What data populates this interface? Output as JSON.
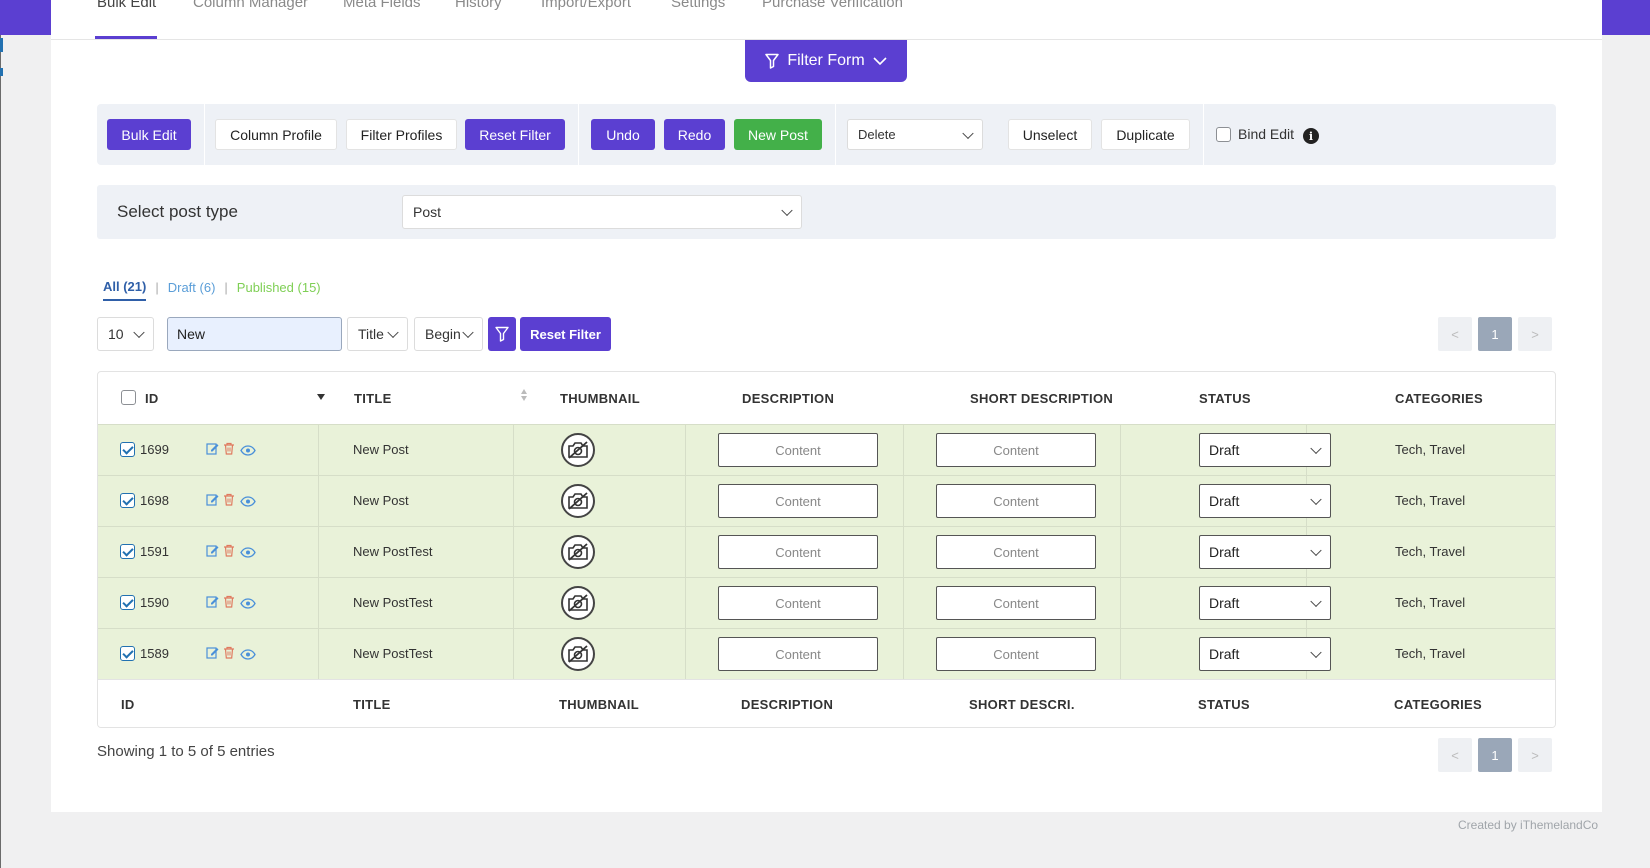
{
  "nav": {
    "tabs": [
      {
        "label": "Bulk Edit",
        "active": true
      },
      {
        "label": "Column Manager",
        "active": false
      },
      {
        "label": "Meta Fields",
        "active": false
      },
      {
        "label": "History",
        "active": false
      },
      {
        "label": "Import/Export",
        "active": false
      },
      {
        "label": "Settings",
        "active": false
      },
      {
        "label": "Purchase Verification",
        "active": false
      }
    ]
  },
  "filter_form": {
    "label": "Filter Form",
    "icon": "funnel-icon"
  },
  "toolbar": {
    "bulk_edit": "Bulk Edit",
    "column_profile": "Column Profile",
    "filter_profiles": "Filter Profiles",
    "reset_filter": "Reset Filter",
    "undo": "Undo",
    "redo": "Redo",
    "new_post": "New Post",
    "action_select": "Delete",
    "unselect": "Unselect",
    "duplicate": "Duplicate",
    "bind_edit": "Bind Edit",
    "bind_edit_checked": false,
    "info_icon": "i"
  },
  "post_type": {
    "label": "Select post type",
    "selected": "Post"
  },
  "status_tabs": {
    "all": "All (21)",
    "draft": "Draft (6)",
    "published": "Published (15)"
  },
  "quick_filter": {
    "per_page": "10",
    "search_value": "New",
    "field": "Title",
    "operator": "Begin",
    "reset_filter": "Reset Filter"
  },
  "pagination": {
    "prev": "<",
    "current": "1",
    "next": ">"
  },
  "table": {
    "headers": {
      "id": "ID",
      "title": "TITLE",
      "thumbnail": "THUMBNAIL",
      "description": "DESCRIPTION",
      "short_description": "SHORT DESCRIPTION",
      "status": "STATUS",
      "categories": "CATEGORIES"
    },
    "footers": {
      "id": "ID",
      "title": "TITLE",
      "thumbnail": "THUMBNAIL",
      "description": "DESCRIPTION",
      "short_description": "SHORT DESCRI.",
      "status": "STATUS",
      "categories": "CATEGORIES"
    },
    "rows": [
      {
        "id": "1699",
        "title": "New Post",
        "description": "Content",
        "short_description": "Content",
        "status": "Draft",
        "categories": "Tech, Travel"
      },
      {
        "id": "1698",
        "title": "New Post",
        "description": "Content",
        "short_description": "Content",
        "status": "Draft",
        "categories": "Tech, Travel"
      },
      {
        "id": "1591",
        "title": "New PostTest",
        "description": "Content",
        "short_description": "Content",
        "status": "Draft",
        "categories": "Tech, Travel"
      },
      {
        "id": "1590",
        "title": "New PostTest",
        "description": "Content",
        "short_description": "Content",
        "status": "Draft",
        "categories": "Tech, Travel"
      },
      {
        "id": "1589",
        "title": "New PostTest",
        "description": "Content",
        "short_description": "Content",
        "status": "Draft",
        "categories": "Tech, Travel"
      }
    ]
  },
  "showing": "Showing 1 to 5 of 5 entries",
  "credit": "Created by iThemelandCo",
  "colors": {
    "primary": "#5b3fd1",
    "success": "#43b049",
    "row_selected": "#e9f2d9"
  }
}
